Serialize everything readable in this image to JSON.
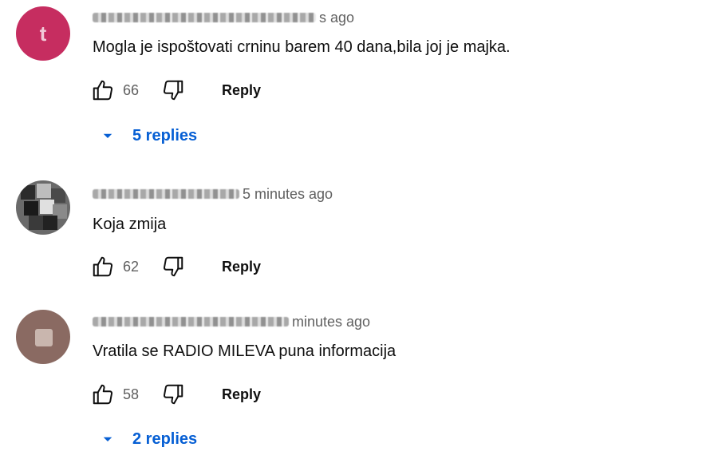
{
  "comments": [
    {
      "avatar": {
        "icon": "avatar-pink-letter",
        "letter": "t",
        "color": "#c62d60"
      },
      "time": "s ago",
      "text": "Mogla je ispoštovati crninu barem 40 dana,bila joj je majka.",
      "likes": "66",
      "reply_label": "Reply",
      "replies_label": "5 replies"
    },
    {
      "avatar": {
        "icon": "avatar-blurred-photo",
        "color": "#6a6a6a"
      },
      "time": "5 minutes ago",
      "text": "Koja zmija",
      "likes": "62",
      "reply_label": "Reply"
    },
    {
      "avatar": {
        "icon": "avatar-brown-photo",
        "color": "#8a6a62"
      },
      "time": "minutes ago",
      "text": "Vratila se RADIO MILEVA puna informacija",
      "likes": "58",
      "reply_label": "Reply",
      "replies_label": "2 replies"
    }
  ],
  "icons": {
    "like": "thumbs-up-icon",
    "dislike": "thumbs-down-icon",
    "expand": "caret-down-icon"
  },
  "colors": {
    "link": "#065fd4",
    "meta": "#606060",
    "text": "#0f0f0f"
  }
}
